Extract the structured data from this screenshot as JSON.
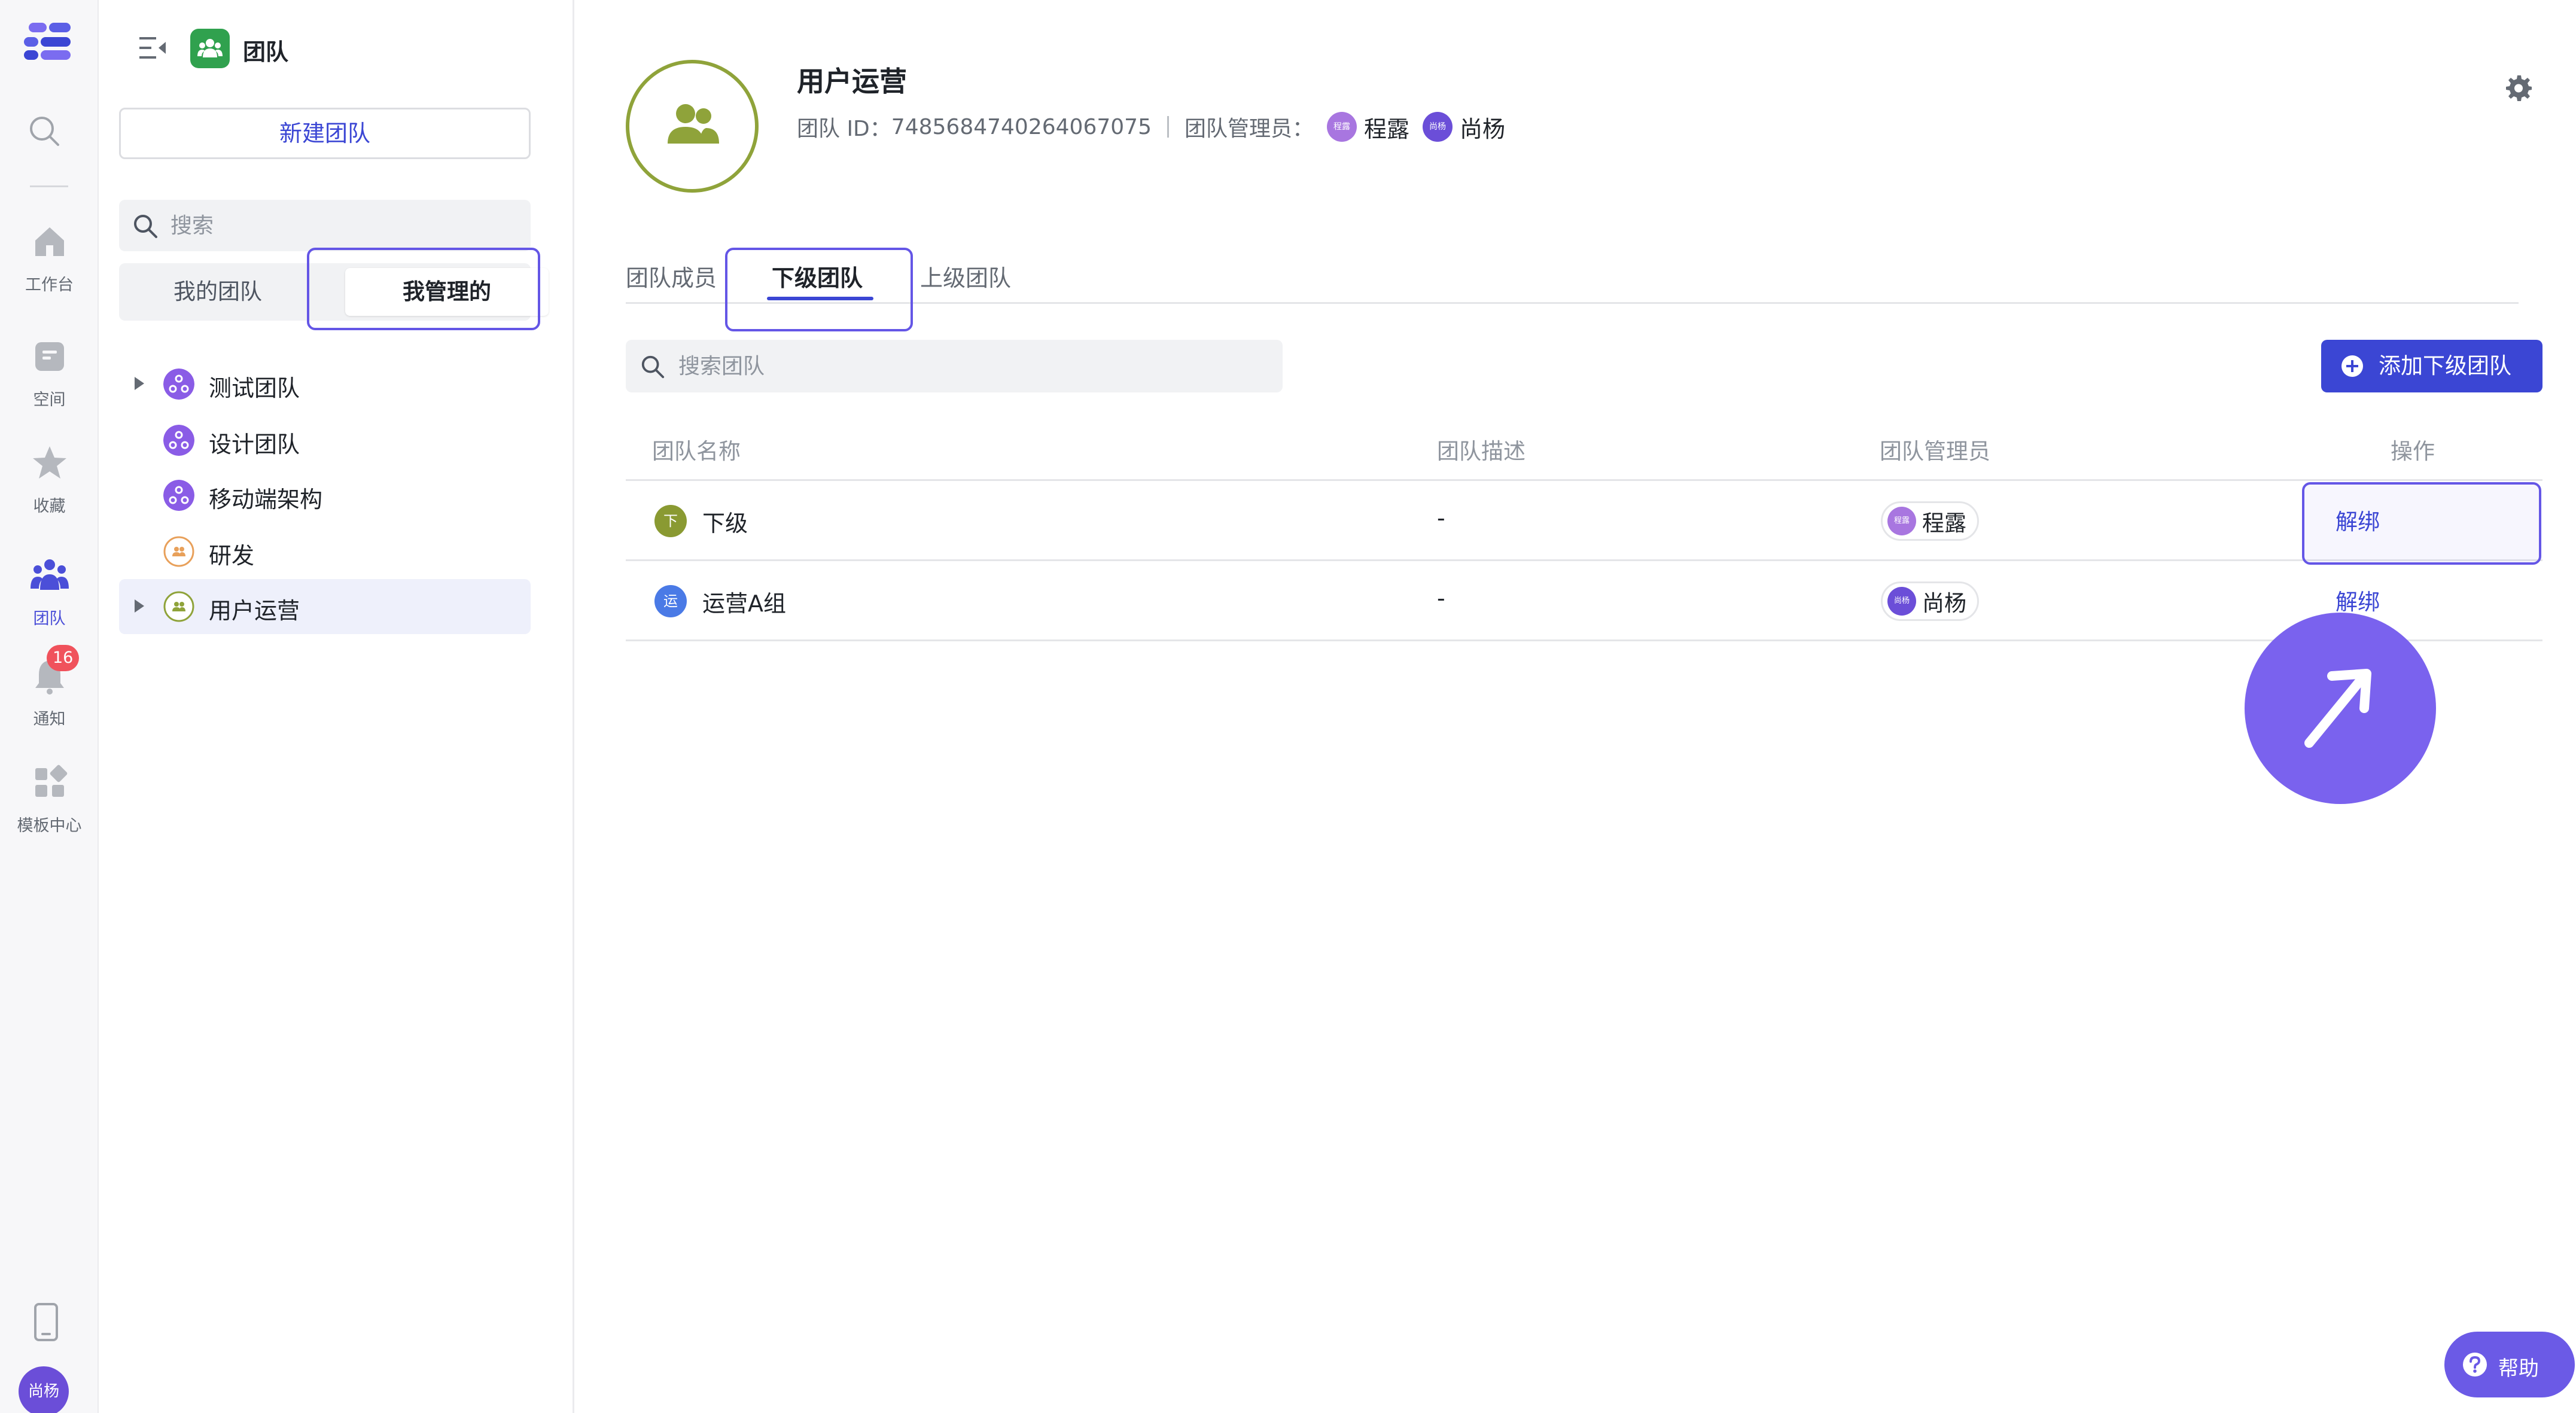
{
  "rail": {
    "items": [
      {
        "label": "工作台"
      },
      {
        "label": "空间"
      },
      {
        "label": "收藏"
      },
      {
        "label": "团队"
      },
      {
        "label": "通知",
        "badge": "16"
      },
      {
        "label": "模板中心"
      }
    ],
    "user_avatar": "尚杨"
  },
  "sidebar": {
    "title": "团队",
    "new_team_label": "新建团队",
    "search_placeholder": "搜索",
    "segments": [
      "我的团队",
      "我管理的"
    ],
    "teams": [
      {
        "label": "测试团队",
        "expandable": true
      },
      {
        "label": "设计团队",
        "expandable": false
      },
      {
        "label": "移动端架构",
        "expandable": false
      },
      {
        "label": "研发",
        "expandable": false
      },
      {
        "label": "用户运营",
        "expandable": true,
        "selected": true
      }
    ]
  },
  "header": {
    "team_name": "用户运营",
    "team_id_label": "团队 ID：",
    "team_id": "7485684740264067075",
    "admins_label": "团队管理员：",
    "admins": [
      {
        "avatar": "程露",
        "name": "程露"
      },
      {
        "avatar": "尚杨",
        "name": "尚杨"
      }
    ]
  },
  "tabs": [
    "团队成员",
    "下级团队",
    "上级团队"
  ],
  "active_tab": "下级团队",
  "toolbar": {
    "search_placeholder": "搜索团队",
    "add_label": "添加下级团队"
  },
  "table": {
    "columns": [
      "团队名称",
      "团队描述",
      "团队管理员",
      "操作"
    ],
    "rows": [
      {
        "icon": "下",
        "name": "下级",
        "desc": "-",
        "admin_avatar": "程露",
        "admin": "程露",
        "action": "解绑"
      },
      {
        "icon": "运",
        "name": "运营A组",
        "desc": "-",
        "admin_avatar": "尚杨",
        "admin": "尚杨",
        "action": "解绑"
      }
    ]
  },
  "help_label": "帮助",
  "colors": {
    "accent": "#3b46d4",
    "highlight": "#6456e6",
    "team_green": "#8fa33a",
    "avatar_purple": "#6b4ed8"
  }
}
